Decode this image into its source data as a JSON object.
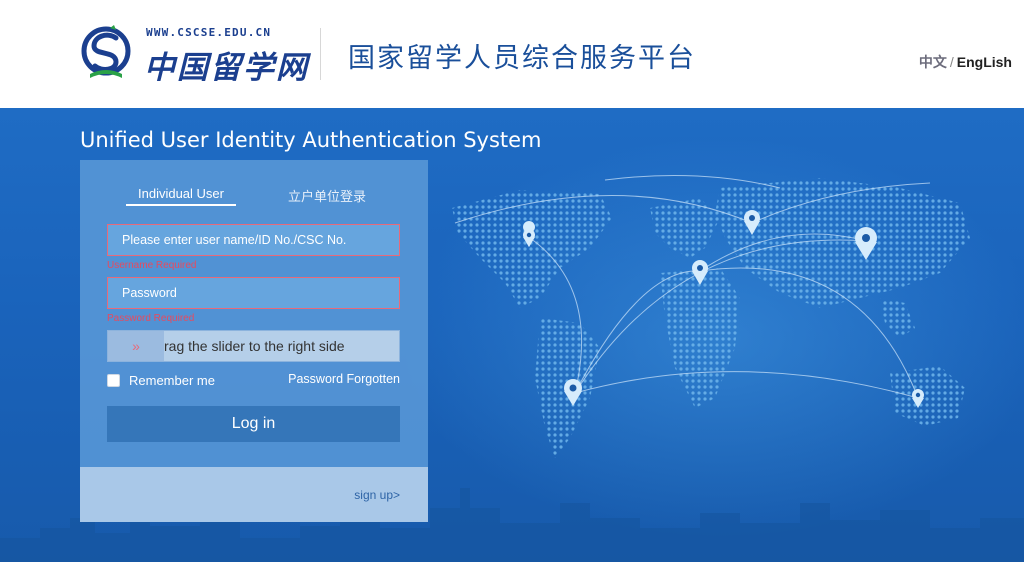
{
  "header": {
    "logo_url_text": "WWW.CSCSE.EDU.CN",
    "logo_name": "中国留学网",
    "platform_title": "国家留学人员综合服务平台",
    "lang_cn": "中文",
    "lang_sep": "/",
    "lang_en": "EngLish"
  },
  "banner": {
    "system_title": "Unified User Identity Authentication System"
  },
  "login": {
    "tab_individual": "Individual User",
    "tab_org": "立户单位登录",
    "username_placeholder": "Please enter user name/ID No./CSC No.",
    "username_error": "Username Required",
    "password_placeholder": "Password",
    "password_error": "Password Required",
    "slider_handle_icon": "»",
    "slider_text": "rag the slider to the right side",
    "remember_label": "Remember me",
    "forgot_label": "Password Forgotten",
    "login_button": "Log in",
    "signup_label": "sign up>"
  },
  "colors": {
    "brand_blue": "#1b3f8f",
    "banner_blue": "#1f6cc4",
    "error_red": "#e84a5e",
    "button_blue": "#3576b9"
  },
  "icons": {
    "logo": "cscse-logo-icon",
    "slider": "double-chevron-right-icon",
    "map_pins": "location-pin-icon"
  }
}
